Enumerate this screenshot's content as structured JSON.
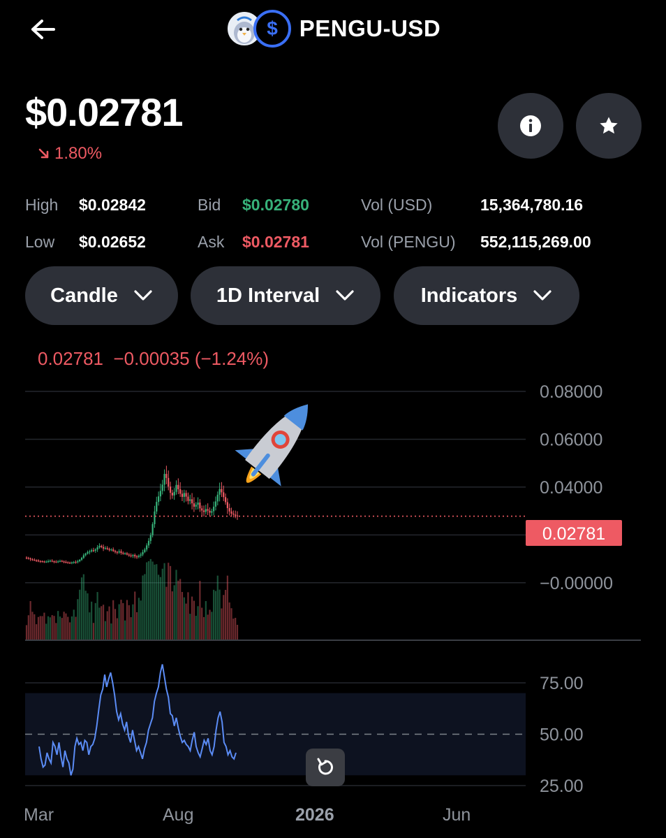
{
  "header": {
    "title": "PENGU-USD",
    "base_icon": "pengu-penguin-icon",
    "quote_icon": "usd-dollar-icon"
  },
  "price": {
    "value": "$0.02781",
    "change": "1.80%",
    "direction": "down"
  },
  "stats": {
    "high_label": "High",
    "high_value": "$0.02842",
    "low_label": "Low",
    "low_value": "$0.02652",
    "bid_label": "Bid",
    "bid_value": "$0.02780",
    "ask_label": "Ask",
    "ask_value": "$0.02781",
    "vol_usd_label": "Vol (USD)",
    "vol_usd_value": "15,364,780.16",
    "vol_base_label": "Vol (PENGU)",
    "vol_base_value": "552,115,269.00"
  },
  "controls": {
    "chart_type": "Candle",
    "interval": "1D Interval",
    "indicators": "Indicators"
  },
  "ohlc_readout": "0.02781  −0.00035 (−1.24%)",
  "colors": {
    "up": "#37b27a",
    "down": "#ee5a63",
    "rsi_line": "#5b8cf5",
    "price_tag": "#ee5a63"
  },
  "chart_data": {
    "type": "candlestick",
    "price_axis_ticks": [
      "0.08000",
      "0.06000",
      "0.04000",
      "0.02000",
      "−0.00000"
    ],
    "price_ylim": [
      -0.01,
      0.08
    ],
    "current_price_tag": "0.02781",
    "current_price": 0.02781,
    "rsi_axis_ticks": [
      "75.00",
      "50.00",
      "25.00"
    ],
    "rsi_ylim": [
      25,
      75
    ],
    "rsi_band": [
      30,
      70
    ],
    "x_tick_labels": [
      "Mar",
      "Aug",
      "2026",
      "Jun"
    ],
    "close_series": [
      0.0104,
      0.0102,
      0.0098,
      0.0096,
      0.0094,
      0.0093,
      0.0091,
      0.009,
      0.0089,
      0.0087,
      0.0088,
      0.009,
      0.0092,
      0.009,
      0.0088,
      0.0087,
      0.0089,
      0.0091,
      0.0089,
      0.0087,
      0.0085,
      0.0084,
      0.0083,
      0.0085,
      0.0087,
      0.0086,
      0.009,
      0.0096,
      0.0104,
      0.0115,
      0.0122,
      0.0128,
      0.0131,
      0.0136,
      0.0134,
      0.0139,
      0.0148,
      0.0154,
      0.0149,
      0.0143,
      0.0145,
      0.0141,
      0.0137,
      0.0139,
      0.0133,
      0.0129,
      0.0127,
      0.0131,
      0.0125,
      0.0121,
      0.0123,
      0.0118,
      0.0114,
      0.0112,
      0.0116,
      0.011,
      0.0108,
      0.0113,
      0.0118,
      0.0128,
      0.0139,
      0.0156,
      0.0175,
      0.0199,
      0.0245,
      0.0298,
      0.0338,
      0.0361,
      0.0384,
      0.041,
      0.0455,
      0.0438,
      0.0402,
      0.0376,
      0.0365,
      0.038,
      0.0409,
      0.0391,
      0.0372,
      0.0359,
      0.0375,
      0.036,
      0.0342,
      0.0349,
      0.0332,
      0.0318,
      0.0326,
      0.0335,
      0.0311,
      0.0302,
      0.0296,
      0.0308,
      0.0301,
      0.0293,
      0.0299,
      0.0318,
      0.034,
      0.0368,
      0.0392,
      0.0378,
      0.0358,
      0.0337,
      0.0312,
      0.0298,
      0.0289,
      0.0285,
      0.0281,
      0.0278
    ],
    "rsi_series": [
      44,
      38,
      34,
      35,
      41,
      38,
      36,
      46,
      44,
      40,
      46,
      39,
      34,
      42,
      38,
      36,
      30,
      33,
      44,
      48,
      45,
      46,
      42,
      47,
      46,
      40,
      44,
      45,
      48,
      54,
      62,
      69,
      72,
      79,
      73,
      77,
      80,
      75,
      69,
      61,
      57,
      60,
      55,
      52,
      56,
      49,
      46,
      52,
      47,
      42,
      44,
      41,
      38,
      43,
      46,
      52,
      55,
      58,
      66,
      70,
      73,
      80,
      84,
      78,
      72,
      68,
      60,
      59,
      54,
      58,
      53,
      49,
      46,
      47,
      45,
      44,
      42,
      47,
      51,
      44,
      41,
      39,
      43,
      47,
      45,
      48,
      42,
      40,
      44,
      52,
      58,
      61,
      56,
      46,
      44,
      40,
      42,
      39,
      38,
      41
    ]
  }
}
